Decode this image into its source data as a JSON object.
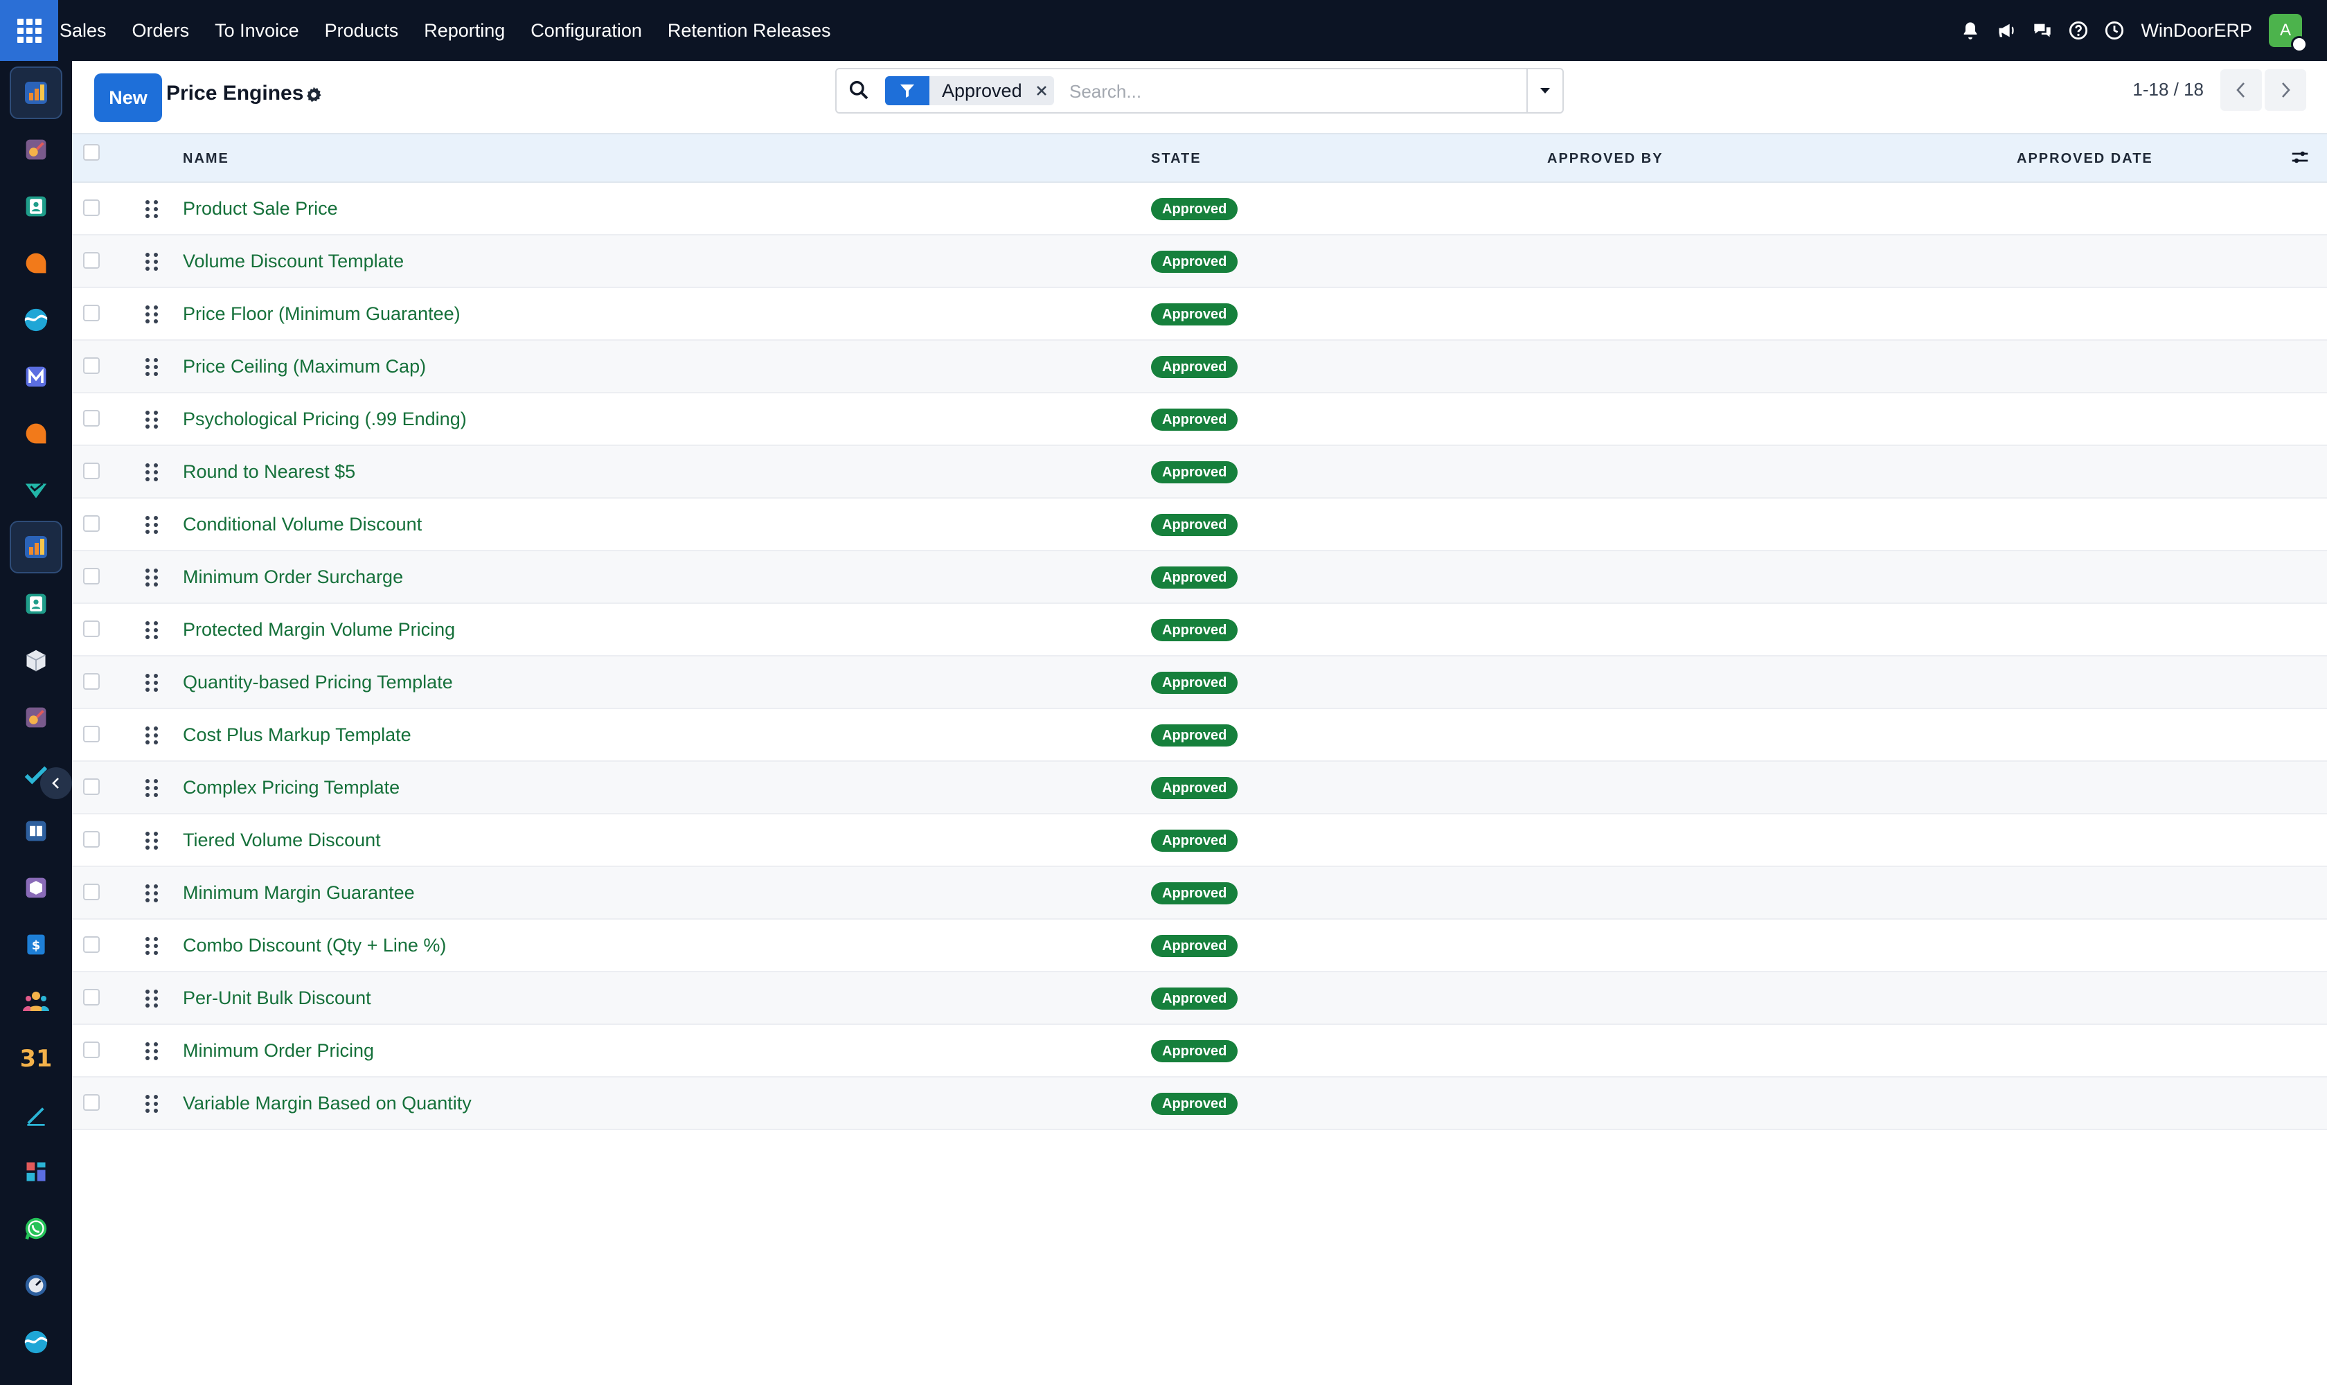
{
  "navbar": {
    "menu": [
      "Sales",
      "Orders",
      "To Invoice",
      "Products",
      "Reporting",
      "Configuration",
      "Retention Releases"
    ],
    "company": "WinDoorERP",
    "avatar_initial": "A",
    "icons": [
      "bell-icon",
      "megaphone-icon",
      "chat-icon",
      "help-icon",
      "clock-icon"
    ]
  },
  "sidebar": {
    "apps": [
      "bar-chart-app-icon",
      "paint-app-icon",
      "contacts-app-icon",
      "chat-bubble-app-icon",
      "wave-app-icon",
      "mail-app-icon",
      "chat-bubble-app-icon",
      "check-tag-app-icon",
      "bar-chart-app-icon",
      "contacts-app-icon",
      "box-app-icon",
      "paint-app-icon",
      "checkmark-app-icon",
      "book-app-icon",
      "package-app-icon",
      "dollar-app-icon",
      "team-app-icon",
      "calendar-app-icon",
      "pen-app-icon",
      "dashboard-app-icon",
      "whatsapp-app-icon",
      "gauge-app-icon",
      "wave-app-icon"
    ],
    "active_indices": [
      0,
      8
    ]
  },
  "control": {
    "new_label": "New",
    "title": "Price Engines",
    "search": {
      "facet_value": "Approved",
      "placeholder": "Search..."
    },
    "pager": "1-18 / 18"
  },
  "list": {
    "columns": {
      "name": "NAME",
      "state": "STATE",
      "approved_by": "APPROVED BY",
      "approved_date": "APPROVED DATE"
    },
    "rows": [
      {
        "name": "Product Sale Price",
        "state": "Approved"
      },
      {
        "name": "Volume Discount Template",
        "state": "Approved"
      },
      {
        "name": "Price Floor (Minimum Guarantee)",
        "state": "Approved"
      },
      {
        "name": "Price Ceiling (Maximum Cap)",
        "state": "Approved"
      },
      {
        "name": "Psychological Pricing (.99 Ending)",
        "state": "Approved"
      },
      {
        "name": "Round to Nearest $5",
        "state": "Approved"
      },
      {
        "name": "Conditional Volume Discount",
        "state": "Approved"
      },
      {
        "name": "Minimum Order Surcharge",
        "state": "Approved"
      },
      {
        "name": "Protected Margin Volume Pricing",
        "state": "Approved"
      },
      {
        "name": "Quantity-based Pricing Template",
        "state": "Approved"
      },
      {
        "name": "Cost Plus Markup Template",
        "state": "Approved"
      },
      {
        "name": "Complex Pricing Template",
        "state": "Approved"
      },
      {
        "name": "Tiered Volume Discount",
        "state": "Approved"
      },
      {
        "name": "Minimum Margin Guarantee",
        "state": "Approved"
      },
      {
        "name": "Combo Discount (Qty + Line %)",
        "state": "Approved"
      },
      {
        "name": "Per-Unit Bulk Discount",
        "state": "Approved"
      },
      {
        "name": "Minimum Order Pricing",
        "state": "Approved"
      },
      {
        "name": "Variable Margin Based on Quantity",
        "state": "Approved"
      }
    ]
  },
  "colors": {
    "navbar_bg": "#0c1424",
    "primary": "#1e6fd9",
    "record_link": "#15703a",
    "badge_success": "#16803c",
    "header_bg": "#e9f2fb"
  }
}
